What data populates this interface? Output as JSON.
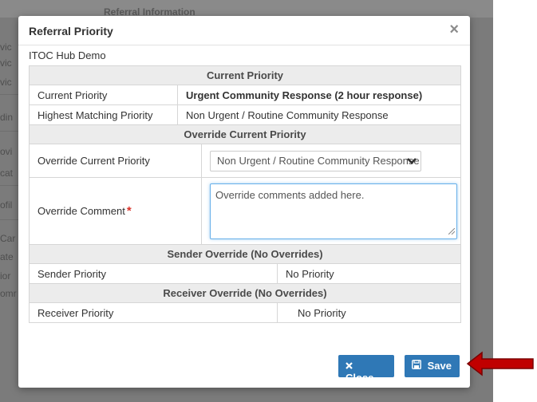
{
  "background": {
    "header_fragment": "Referral Information",
    "side_fragments": [
      "vic",
      "vic",
      "vic",
      "din",
      "ovi",
      "cat",
      "ofil",
      "Car",
      "ate",
      "ior",
      "omr"
    ]
  },
  "modal": {
    "title": "Referral Priority",
    "close_glyph": "×",
    "org_name": "ITOC Hub Demo"
  },
  "current_priority": {
    "section_title": "Current Priority",
    "rows": [
      {
        "label": "Current Priority",
        "value": "Urgent Community Response (2 hour response)"
      },
      {
        "label": "Highest Matching Priority",
        "value": "Non Urgent / Routine Community Response"
      }
    ]
  },
  "override": {
    "section_title": "Override Current Priority",
    "priority_label": "Override Current Priority",
    "priority_selected": "Non Urgent / Routine Community Response",
    "comment_label": "Override Comment",
    "comment_required_mark": "*",
    "comment_value": "Override comments added here."
  },
  "sender_override": {
    "section_title": "Sender Override (No Overrides)",
    "label": "Sender Priority",
    "value": "No Priority"
  },
  "receiver_override": {
    "section_title": "Receiver Override (No Overrides)",
    "label": "Receiver Priority",
    "value": "No Priority"
  },
  "buttons": {
    "close_label": "Close",
    "save_label": "Save"
  },
  "icons": {
    "close_button_icon": "x-mark-icon",
    "save_button_icon": "floppy-disk-icon",
    "select_icon": "chevron-down-icon"
  },
  "colors": {
    "primary_button": "#2f78b6",
    "required_star": "#d9342b",
    "annotation_arrow": "#c00000",
    "section_header_bg": "#ececec"
  }
}
